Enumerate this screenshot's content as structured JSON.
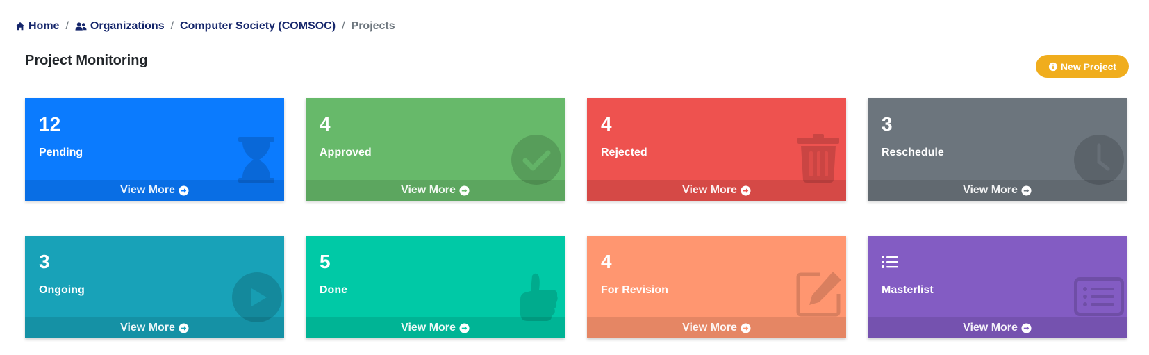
{
  "breadcrumb": {
    "home": "Home",
    "organizations": "Organizations",
    "org": "Computer Society (COMSOC)",
    "current": "Projects",
    "separator": "/"
  },
  "title": "Project Monitoring",
  "new_project_label": "New Project",
  "colors": {
    "accent": "#f0ad1d",
    "breadcrumb_link": "#15266b",
    "pending": "#0b7bfe",
    "approved": "#67b96a",
    "rejected": "#ee524f",
    "reschedule": "#6c757d",
    "ongoing": "#18a2b8",
    "done": "#00c9a6",
    "revision": "#ff9670",
    "masterlist": "#835cc3"
  },
  "cards": [
    {
      "count": "12",
      "label": "Pending",
      "icon": "hourglass-icon",
      "footer": "View More"
    },
    {
      "count": "4",
      "label": "Approved",
      "icon": "check-circle-icon",
      "footer": "View More"
    },
    {
      "count": "4",
      "label": "Rejected",
      "icon": "trash-icon",
      "footer": "View More"
    },
    {
      "count": "3",
      "label": "Reschedule",
      "icon": "clock-icon",
      "footer": "View More"
    },
    {
      "count": "3",
      "label": "Ongoing",
      "icon": "play-circle-icon",
      "footer": "View More"
    },
    {
      "count": "5",
      "label": "Done",
      "icon": "thumbs-up-icon",
      "footer": "View More"
    },
    {
      "count": "4",
      "label": "For Revision",
      "icon": "edit-icon",
      "footer": "View More"
    },
    {
      "count": "",
      "label": "Masterlist",
      "icon": "list-alt-icon",
      "footer": "View More"
    }
  ]
}
